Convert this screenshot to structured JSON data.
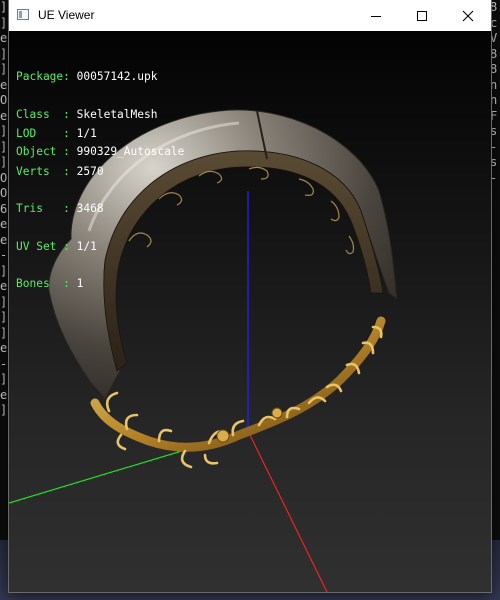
{
  "window": {
    "title": "UE Viewer"
  },
  "info": {
    "package_label": "Package:",
    "package_value": "00057142.upk",
    "class_label": "Class  :",
    "class_value": "SkeletalMesh",
    "object_label": "Object :",
    "object_value": "990329_Autoscale",
    "lod_label": "LOD    :",
    "lod_value": "1/1",
    "verts_label": "Verts  :",
    "verts_value": "2570",
    "tris_label": "Tris   :",
    "tris_value": "3468",
    "uvset_label": "UV Set :",
    "uvset_value": "1/1",
    "bones_label": "Bones  :",
    "bones_value": "1"
  },
  "background_left": [
    "]",
    "]",
    "e",
    "]",
    "]",
    "e",
    "O",
    "e",
    "]",
    "]",
    "]",
    "O",
    "O",
    "6",
    "e",
    "e",
    "-",
    "]",
    "e",
    "]",
    "]",
    "]",
    "e",
    "-",
    "]",
    "e",
    "]"
  ],
  "background_right": [
    "",
    "",
    "",
    "",
    "",
    "",
    "",
    "",
    "",
    "8",
    "c",
    "V",
    "",
    "",
    "8",
    "8",
    "n",
    "",
    "n",
    "F",
    "s",
    "-",
    "",
    "",
    "",
    "",
    "s",
    "-"
  ],
  "colors": {
    "info_label": "#56f060",
    "info_value": "#ffffff",
    "axis_x": "#ff2020",
    "axis_y": "#20e020",
    "axis_z": "#2020ff"
  }
}
